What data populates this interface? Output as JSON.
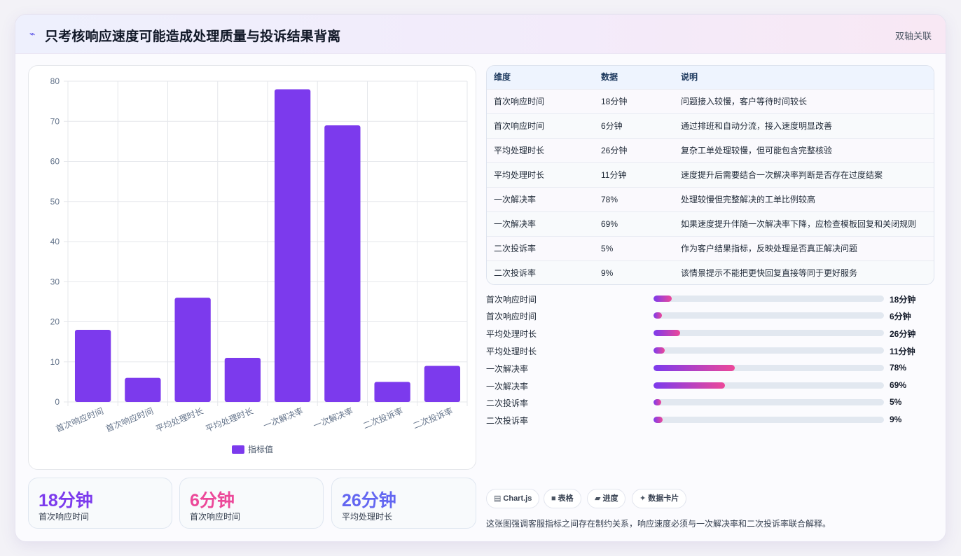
{
  "header": {
    "icon": "lightning-icon",
    "title": "只考核响应速度可能造成处理质量与投诉结果背离",
    "tag": "双轴关联"
  },
  "chart_data": {
    "type": "bar",
    "categories": [
      "首次响应时间",
      "首次响应时间",
      "平均处理时长",
      "平均处理时长",
      "一次解决率",
      "一次解决率",
      "二次投诉率",
      "二次投诉率"
    ],
    "series": [
      {
        "name": "指标值",
        "values": [
          18,
          6,
          26,
          11,
          78,
          69,
          5,
          9
        ]
      }
    ],
    "ylim": [
      0,
      80
    ],
    "yticks": [
      "0",
      "10",
      "20",
      "30",
      "40",
      "50",
      "60",
      "70",
      "80"
    ],
    "grid": true,
    "legend": "bottom",
    "color": "#7c3aed"
  },
  "stats": [
    {
      "value": "18分钟",
      "label": "首次响应时间",
      "color": "#7c3aed"
    },
    {
      "value": "6分钟",
      "label": "首次响应时间",
      "color": "#ec4899"
    },
    {
      "value": "26分钟",
      "label": "平均处理时长",
      "color": "#6366f1"
    }
  ],
  "table": {
    "headers": [
      "维度",
      "数据",
      "说明"
    ],
    "rows": [
      [
        "首次响应时间",
        "18分钟",
        "问题接入较慢，客户等待时间较长"
      ],
      [
        "首次响应时间",
        "6分钟",
        "通过排班和自动分流，接入速度明显改善"
      ],
      [
        "平均处理时长",
        "26分钟",
        "复杂工单处理较慢，但可能包含完整核验"
      ],
      [
        "平均处理时长",
        "11分钟",
        "速度提升后需要结合一次解决率判断是否存在过度结案"
      ],
      [
        "一次解决率",
        "78%",
        "处理较慢但完整解决的工单比例较高"
      ],
      [
        "一次解决率",
        "69%",
        "如果速度提升伴随一次解决率下降，应检查模板回复和关闭规则"
      ],
      [
        "二次投诉率",
        "5%",
        "作为客户结果指标，反映处理是否真正解决问题"
      ],
      [
        "二次投诉率",
        "9%",
        "该情景提示不能把更快回复直接等同于更好服务"
      ]
    ]
  },
  "progress": [
    {
      "label": "首次响应时间",
      "value": "18分钟",
      "fraction": 0.08
    },
    {
      "label": "首次响应时间",
      "value": "6分钟",
      "fraction": 0.035
    },
    {
      "label": "平均处理时长",
      "value": "26分钟",
      "fraction": 0.115
    },
    {
      "label": "平均处理时长",
      "value": "11分钟",
      "fraction": 0.05
    },
    {
      "label": "一次解决率",
      "value": "78%",
      "fraction": 0.353
    },
    {
      "label": "一次解决率",
      "value": "69%",
      "fraction": 0.31
    },
    {
      "label": "二次投诉率",
      "value": "5%",
      "fraction": 0.033
    },
    {
      "label": "二次投诉率",
      "value": "9%",
      "fraction": 0.04
    }
  ],
  "chips": [
    {
      "icon": "chart-icon",
      "glyph": "▤",
      "label": "Chart.js"
    },
    {
      "icon": "table-icon",
      "glyph": "■",
      "label": "表格"
    },
    {
      "icon": "progress-icon",
      "glyph": "▰",
      "label": "进度"
    },
    {
      "icon": "sparkle-icon",
      "glyph": "✦",
      "label": "数据卡片"
    }
  ],
  "note": "这张图强调客服指标之间存在制约关系，响应速度必须与一次解决率和二次投诉率联合解释。"
}
